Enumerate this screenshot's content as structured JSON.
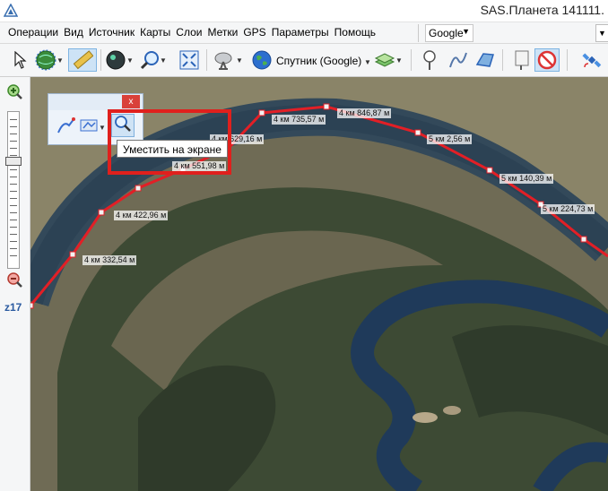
{
  "window": {
    "title": "SAS.Планета 141111."
  },
  "menu": {
    "items": [
      {
        "label": "Операции"
      },
      {
        "label": "Вид"
      },
      {
        "label": "Источник"
      },
      {
        "label": "Карты"
      },
      {
        "label": "Слои"
      },
      {
        "label": "Метки"
      },
      {
        "label": "GPS"
      },
      {
        "label": "Параметры"
      },
      {
        "label": "Помощь"
      }
    ],
    "map_source": "Google"
  },
  "toolbar": {
    "map_type_label": "Спутник (Google)",
    "icons": [
      "cursor-icon",
      "globe-nav-icon",
      "ruler-icon",
      "sphere-icon",
      "magnifier-icon",
      "fullscreen-icon",
      "satellite-dish-icon",
      "earth-icon",
      "layers-icon",
      "pushpin-icon",
      "path-icon",
      "polygon-icon",
      "marks-icon",
      "no-marks-icon",
      "satellite-gps-icon"
    ]
  },
  "zoom": {
    "level": "z17"
  },
  "route": {
    "color": "#e21f26",
    "labels": [
      {
        "text": "4 км 332,54 м"
      },
      {
        "text": "4 км 422,96 м"
      },
      {
        "text": "4 км 551,98 м"
      },
      {
        "text": "4 км 629,16 м"
      },
      {
        "text": "4 км 735,57 м"
      },
      {
        "text": "4 км 846,87 м"
      },
      {
        "text": "5 км 2,56 м"
      },
      {
        "text": "5 км 140,39 м"
      },
      {
        "text": "5 км 224,73 м"
      }
    ]
  },
  "edit_panel": {
    "close_label": "x",
    "tooltip": "Уместить на экране",
    "highlight_color": "#e0201d"
  }
}
